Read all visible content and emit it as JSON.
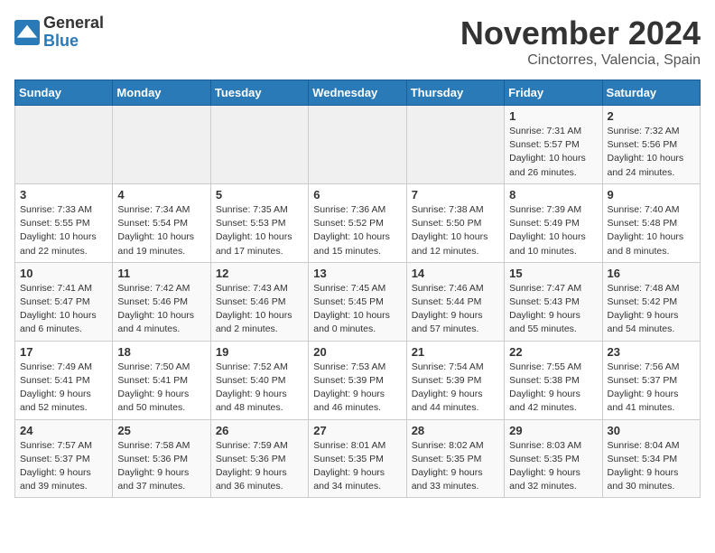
{
  "header": {
    "logo_general": "General",
    "logo_blue": "Blue",
    "month_title": "November 2024",
    "subtitle": "Cinctorres, Valencia, Spain"
  },
  "days_of_week": [
    "Sunday",
    "Monday",
    "Tuesday",
    "Wednesday",
    "Thursday",
    "Friday",
    "Saturday"
  ],
  "weeks": [
    [
      {
        "day": "",
        "info": ""
      },
      {
        "day": "",
        "info": ""
      },
      {
        "day": "",
        "info": ""
      },
      {
        "day": "",
        "info": ""
      },
      {
        "day": "",
        "info": ""
      },
      {
        "day": "1",
        "info": "Sunrise: 7:31 AM\nSunset: 5:57 PM\nDaylight: 10 hours and 26 minutes."
      },
      {
        "day": "2",
        "info": "Sunrise: 7:32 AM\nSunset: 5:56 PM\nDaylight: 10 hours and 24 minutes."
      }
    ],
    [
      {
        "day": "3",
        "info": "Sunrise: 7:33 AM\nSunset: 5:55 PM\nDaylight: 10 hours and 22 minutes."
      },
      {
        "day": "4",
        "info": "Sunrise: 7:34 AM\nSunset: 5:54 PM\nDaylight: 10 hours and 19 minutes."
      },
      {
        "day": "5",
        "info": "Sunrise: 7:35 AM\nSunset: 5:53 PM\nDaylight: 10 hours and 17 minutes."
      },
      {
        "day": "6",
        "info": "Sunrise: 7:36 AM\nSunset: 5:52 PM\nDaylight: 10 hours and 15 minutes."
      },
      {
        "day": "7",
        "info": "Sunrise: 7:38 AM\nSunset: 5:50 PM\nDaylight: 10 hours and 12 minutes."
      },
      {
        "day": "8",
        "info": "Sunrise: 7:39 AM\nSunset: 5:49 PM\nDaylight: 10 hours and 10 minutes."
      },
      {
        "day": "9",
        "info": "Sunrise: 7:40 AM\nSunset: 5:48 PM\nDaylight: 10 hours and 8 minutes."
      }
    ],
    [
      {
        "day": "10",
        "info": "Sunrise: 7:41 AM\nSunset: 5:47 PM\nDaylight: 10 hours and 6 minutes."
      },
      {
        "day": "11",
        "info": "Sunrise: 7:42 AM\nSunset: 5:46 PM\nDaylight: 10 hours and 4 minutes."
      },
      {
        "day": "12",
        "info": "Sunrise: 7:43 AM\nSunset: 5:46 PM\nDaylight: 10 hours and 2 minutes."
      },
      {
        "day": "13",
        "info": "Sunrise: 7:45 AM\nSunset: 5:45 PM\nDaylight: 10 hours and 0 minutes."
      },
      {
        "day": "14",
        "info": "Sunrise: 7:46 AM\nSunset: 5:44 PM\nDaylight: 9 hours and 57 minutes."
      },
      {
        "day": "15",
        "info": "Sunrise: 7:47 AM\nSunset: 5:43 PM\nDaylight: 9 hours and 55 minutes."
      },
      {
        "day": "16",
        "info": "Sunrise: 7:48 AM\nSunset: 5:42 PM\nDaylight: 9 hours and 54 minutes."
      }
    ],
    [
      {
        "day": "17",
        "info": "Sunrise: 7:49 AM\nSunset: 5:41 PM\nDaylight: 9 hours and 52 minutes."
      },
      {
        "day": "18",
        "info": "Sunrise: 7:50 AM\nSunset: 5:41 PM\nDaylight: 9 hours and 50 minutes."
      },
      {
        "day": "19",
        "info": "Sunrise: 7:52 AM\nSunset: 5:40 PM\nDaylight: 9 hours and 48 minutes."
      },
      {
        "day": "20",
        "info": "Sunrise: 7:53 AM\nSunset: 5:39 PM\nDaylight: 9 hours and 46 minutes."
      },
      {
        "day": "21",
        "info": "Sunrise: 7:54 AM\nSunset: 5:39 PM\nDaylight: 9 hours and 44 minutes."
      },
      {
        "day": "22",
        "info": "Sunrise: 7:55 AM\nSunset: 5:38 PM\nDaylight: 9 hours and 42 minutes."
      },
      {
        "day": "23",
        "info": "Sunrise: 7:56 AM\nSunset: 5:37 PM\nDaylight: 9 hours and 41 minutes."
      }
    ],
    [
      {
        "day": "24",
        "info": "Sunrise: 7:57 AM\nSunset: 5:37 PM\nDaylight: 9 hours and 39 minutes."
      },
      {
        "day": "25",
        "info": "Sunrise: 7:58 AM\nSunset: 5:36 PM\nDaylight: 9 hours and 37 minutes."
      },
      {
        "day": "26",
        "info": "Sunrise: 7:59 AM\nSunset: 5:36 PM\nDaylight: 9 hours and 36 minutes."
      },
      {
        "day": "27",
        "info": "Sunrise: 8:01 AM\nSunset: 5:35 PM\nDaylight: 9 hours and 34 minutes."
      },
      {
        "day": "28",
        "info": "Sunrise: 8:02 AM\nSunset: 5:35 PM\nDaylight: 9 hours and 33 minutes."
      },
      {
        "day": "29",
        "info": "Sunrise: 8:03 AM\nSunset: 5:35 PM\nDaylight: 9 hours and 32 minutes."
      },
      {
        "day": "30",
        "info": "Sunrise: 8:04 AM\nSunset: 5:34 PM\nDaylight: 9 hours and 30 minutes."
      }
    ]
  ]
}
